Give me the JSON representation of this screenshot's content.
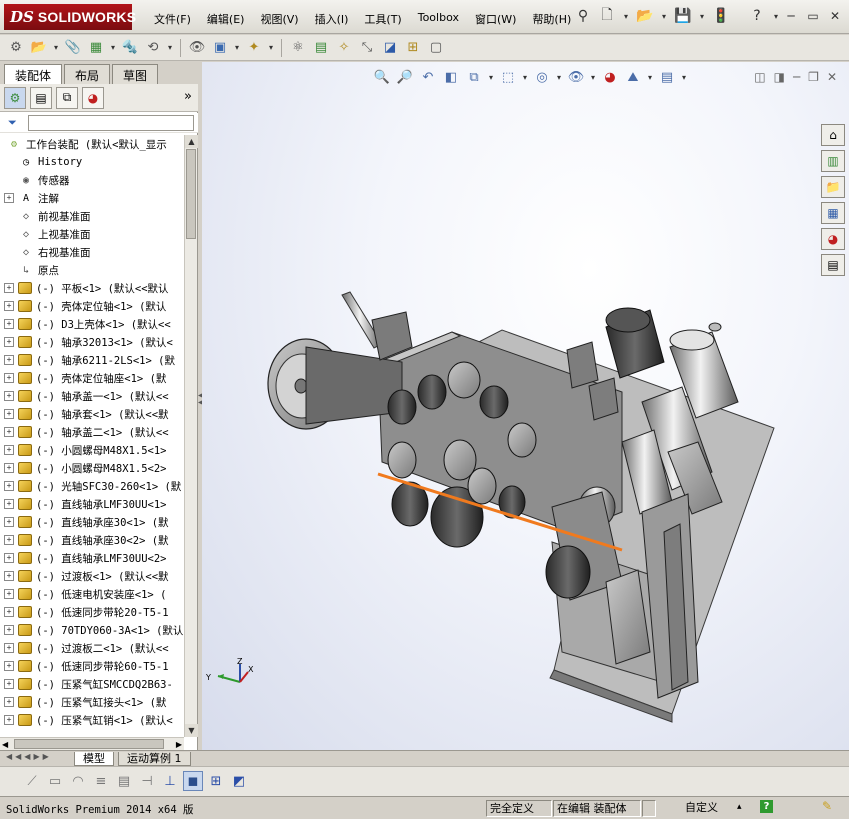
{
  "app": {
    "logo_mark": "DS",
    "logo_text": "SOLIDWORKS"
  },
  "menu": [
    "文件(F)",
    "编辑(E)",
    "视图(V)",
    "插入(I)",
    "工具(T)",
    "Toolbox",
    "窗口(W)",
    "帮助(H)"
  ],
  "panel_tabs": [
    "装配体",
    "布局",
    "草图"
  ],
  "tree": {
    "root": "工作台装配  (默认<默认_显示",
    "items": [
      {
        "icon": "history-icon",
        "label": "History",
        "expandable": false
      },
      {
        "icon": "sensor-icon",
        "label": "传感器",
        "expandable": false
      },
      {
        "icon": "annotation-icon",
        "label": "注解",
        "expandable": true
      },
      {
        "icon": "plane-icon",
        "label": "前视基准面",
        "expandable": false
      },
      {
        "icon": "plane-icon",
        "label": "上视基准面",
        "expandable": false
      },
      {
        "icon": "plane-icon",
        "label": "右视基准面",
        "expandable": false
      },
      {
        "icon": "origin-icon",
        "label": "原点",
        "expandable": false
      },
      {
        "icon": "part-icon",
        "label": "(-) 平板<1> (默认<<默认",
        "expandable": true
      },
      {
        "icon": "part-icon",
        "label": "(-) 壳体定位轴<1> (默认",
        "expandable": true
      },
      {
        "icon": "part-icon",
        "label": "(-) D3上壳体<1> (默认<<",
        "expandable": true
      },
      {
        "icon": "part-icon",
        "label": "(-) 轴承32013<1> (默认<",
        "expandable": true
      },
      {
        "icon": "part-icon",
        "label": "(-) 轴承6211-2LS<1> (默",
        "expandable": true
      },
      {
        "icon": "part-icon",
        "label": "(-) 壳体定位轴座<1> (默",
        "expandable": true
      },
      {
        "icon": "part-icon",
        "label": "(-) 轴承盖一<1> (默认<<",
        "expandable": true
      },
      {
        "icon": "part-icon",
        "label": "(-) 轴承套<1> (默认<<默",
        "expandable": true
      },
      {
        "icon": "part-icon",
        "label": "(-) 轴承盖二<1> (默认<<",
        "expandable": true
      },
      {
        "icon": "part-icon",
        "label": "(-) 小圆螺母M48X1.5<1>",
        "expandable": true
      },
      {
        "icon": "part-icon",
        "label": "(-) 小圆螺母M48X1.5<2>",
        "expandable": true
      },
      {
        "icon": "part-icon",
        "label": "(-) 光轴SFC30-260<1> (默",
        "expandable": true
      },
      {
        "icon": "part-icon",
        "label": "(-) 直线轴承LMF30UU<1>",
        "expandable": true
      },
      {
        "icon": "part-icon",
        "label": "(-) 直线轴承座30<1> (默",
        "expandable": true
      },
      {
        "icon": "part-icon",
        "label": "(-) 直线轴承座30<2> (默",
        "expandable": true
      },
      {
        "icon": "part-icon",
        "label": "(-) 直线轴承LMF30UU<2>",
        "expandable": true
      },
      {
        "icon": "part-icon",
        "label": "(-) 过渡板<1> (默认<<默",
        "expandable": true
      },
      {
        "icon": "part-icon",
        "label": "(-) 低速电机安装座<1> (",
        "expandable": true
      },
      {
        "icon": "part-icon",
        "label": "(-) 低速同步带轮20-T5-1",
        "expandable": true
      },
      {
        "icon": "part-icon",
        "label": "(-) 70TDY060-3A<1> (默认",
        "expandable": true
      },
      {
        "icon": "part-icon",
        "label": "(-) 过渡板二<1> (默认<<",
        "expandable": true
      },
      {
        "icon": "part-icon",
        "label": "(-) 低速同步带轮60-T5-1",
        "expandable": true
      },
      {
        "icon": "part-icon",
        "label": "(-) 压紧气缸SMCCDQ2B63-",
        "expandable": true
      },
      {
        "icon": "part-icon",
        "label": "(-) 压紧气缸接头<1> (默",
        "expandable": true
      },
      {
        "icon": "part-icon",
        "label": "(-) 压紧气缸销<1> (默认<",
        "expandable": true
      }
    ]
  },
  "bottom_tabs": [
    "模型",
    "运动算例 1"
  ],
  "status": {
    "version": "SolidWorks Premium 2014 x64 版",
    "definition": "完全定义",
    "editing": "在编辑 装配体",
    "units": "自定义",
    "units_arrow": "▴",
    "help": "?"
  },
  "triad": {
    "x": "X",
    "y": "Y",
    "z": "Z"
  },
  "colors": {
    "logo_red": "#a01016",
    "highlight_edge": "#f07a1e"
  }
}
